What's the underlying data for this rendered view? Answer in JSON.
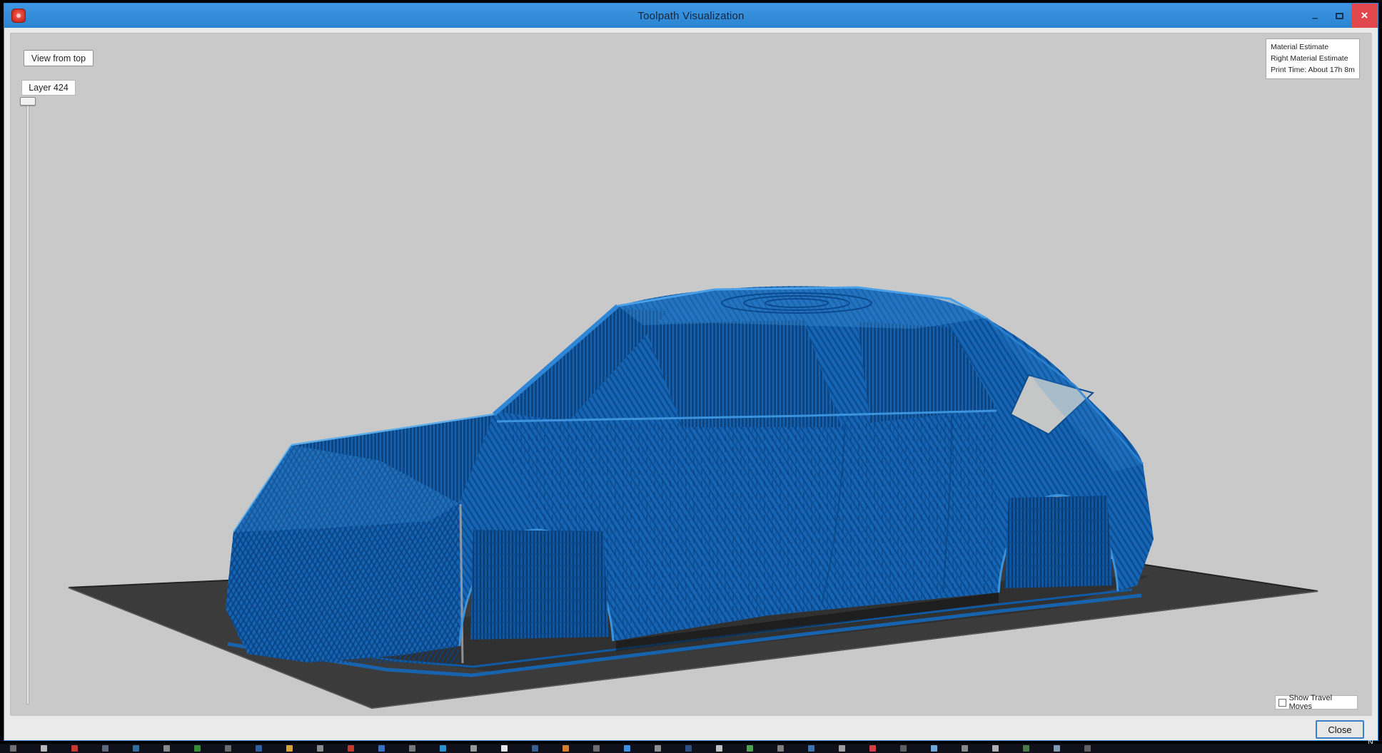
{
  "window": {
    "title": "Toolpath Visualization",
    "minimize_glyph": "–",
    "close_glyph": "×"
  },
  "controls": {
    "view_from_top": "View from top",
    "layer_indicator": "Layer 424"
  },
  "info_panel": {
    "lines": [
      "Material Estimate",
      "Right Material Estimate",
      "Print Time: About 17h 8m"
    ]
  },
  "footer": {
    "show_travel_moves": "Show Travel Moves",
    "travel_moves_checked": false,
    "close_button": "Close"
  },
  "desktop": {
    "stray_text": "N"
  },
  "scene": {
    "description": "3D toolpath preview of a car body shell printed in blue on a dark build plate, viewed from front-left three-quarter angle",
    "model_color": "#1565b4",
    "model_dark": "#0b4a8e",
    "model_light": "#3b93dd",
    "plate_color": "#3b3b3b",
    "background": "#c9c9c9",
    "titlebar_color": "#2e8ad8"
  },
  "taskbar": {
    "icons": [
      "#707070",
      "#b8b8b8",
      "#c23b2e",
      "#5a6a7a",
      "#2e6f9e",
      "#888888",
      "#3a8a3a",
      "#6a6a6a",
      "#2e5f9e",
      "#d2a53c",
      "#8a8a8a",
      "#c13a2c",
      "#3a6fc0",
      "#787878",
      "#2e90d0",
      "#989898",
      "#e6e6e6",
      "#3a5f90",
      "#d07f30",
      "#6e6e6e",
      "#3f90e0",
      "#8e8e8e",
      "#2e4f80",
      "#c0c0c0",
      "#4fa050",
      "#7e7e7e",
      "#3f70b0",
      "#9e9e9e",
      "#d04040",
      "#5e5e5e",
      "#70a8d8",
      "#888888",
      "#b0b0b0",
      "#4a7a4a",
      "#8098b0",
      "#606060"
    ]
  }
}
